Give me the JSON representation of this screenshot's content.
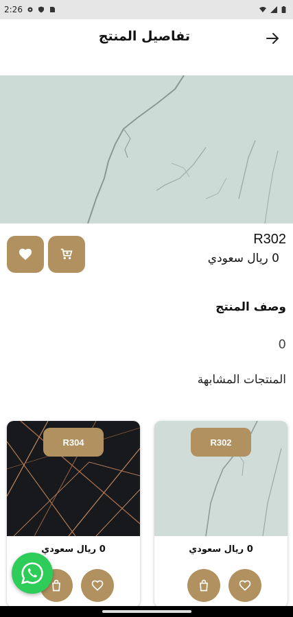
{
  "status_bar": {
    "time": "2:26"
  },
  "app_bar": {
    "title": "تفاصيل المنتج"
  },
  "product": {
    "code": "R302",
    "price": "0 ريال سعودي",
    "description_heading": "وصف المنتج",
    "description": "0"
  },
  "similar": {
    "heading": "المنتجات المشابهة",
    "items": [
      {
        "code": "R302",
        "price": "0 ريال سعودي"
      },
      {
        "code": "R304",
        "price": "0 ريال سعودي"
      }
    ]
  },
  "colors": {
    "accent": "#b0915f",
    "whatsapp": "#2ecc58"
  }
}
